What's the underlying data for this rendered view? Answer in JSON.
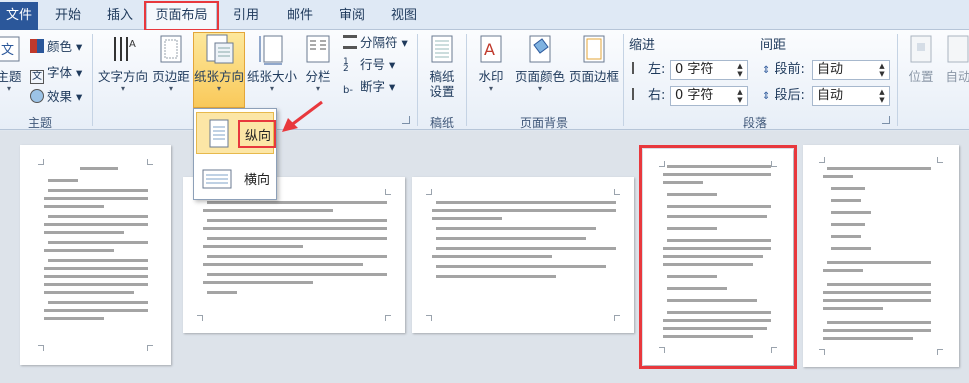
{
  "tabs": {
    "file": "文件",
    "items": [
      "开始",
      "插入",
      "页面布局",
      "引用",
      "邮件",
      "审阅",
      "视图"
    ],
    "active_index": 2
  },
  "ribbon": {
    "theme_group": {
      "label": "主题",
      "themes_btn": "主题",
      "colors": "颜色",
      "fonts": "字体",
      "effects": "效果"
    },
    "page_setup": {
      "text_direction": "文字方向",
      "margins": "页边距",
      "orientation": "纸张方向",
      "size": "纸张大小",
      "columns": "分栏",
      "breaks": "分隔符",
      "line_numbers": "行号",
      "hyphenation": "断字"
    },
    "draft_group": {
      "label": "稿纸",
      "draft_btn_line1": "稿纸",
      "draft_btn_line2": "设置"
    },
    "background_group": {
      "label": "页面背景",
      "watermark": "水印",
      "page_color": "页面颜色",
      "page_borders": "页面边框"
    },
    "paragraph_group": {
      "label": "段落",
      "indent_title": "缩进",
      "spacing_title": "间距",
      "left_label": "左:",
      "left_value": "0 字符",
      "right_label": "右:",
      "right_value": "0 字符",
      "before_label": "段前:",
      "before_value": "自动",
      "after_label": "段后:",
      "after_value": "自动"
    },
    "arrange_group": {
      "position": "位置",
      "wrap": "自动"
    }
  },
  "orientation_menu": {
    "portrait": "纵向",
    "landscape": "横向",
    "selected": "portrait"
  },
  "colors": {
    "highlight": "#e8383d",
    "file_tab": "#2b579a",
    "selected_fill": "#fce6a6"
  }
}
